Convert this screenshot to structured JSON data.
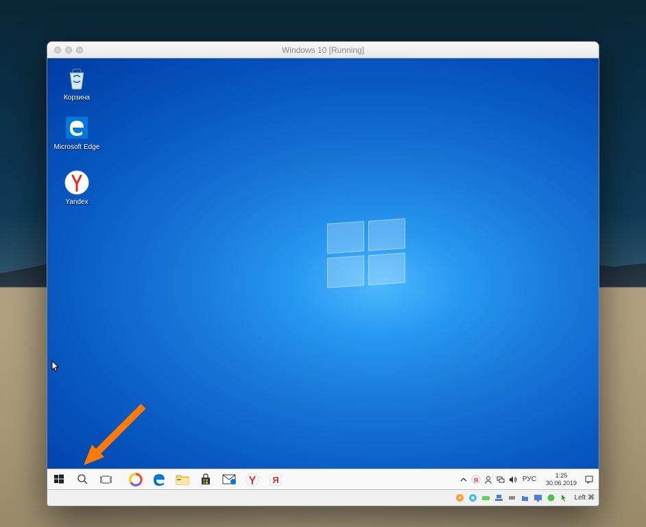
{
  "window": {
    "title": "Windows 10 [Running]"
  },
  "desktop_icons": [
    {
      "name": "recycle-bin",
      "label": "Корзина"
    },
    {
      "name": "edge",
      "label": "Microsoft Edge"
    },
    {
      "name": "yandex",
      "label": "Yandex"
    }
  ],
  "taskbar": {
    "items": [
      {
        "name": "start-button"
      },
      {
        "name": "search-button"
      },
      {
        "name": "task-view-button"
      },
      {
        "name": "yandex-browser"
      },
      {
        "name": "edge-browser"
      },
      {
        "name": "file-explorer"
      },
      {
        "name": "microsoft-store"
      },
      {
        "name": "mail-app"
      },
      {
        "name": "yandex-disk"
      },
      {
        "name": "yandex-app"
      }
    ]
  },
  "systray": {
    "items": [
      {
        "name": "chevron-up-icon"
      },
      {
        "name": "yandex-tray-icon"
      },
      {
        "name": "people-icon"
      },
      {
        "name": "network-icon"
      },
      {
        "name": "volume-icon"
      }
    ],
    "language": "РУС",
    "time": "1:25",
    "date": "30.06.2019"
  },
  "host_statusbar": {
    "host_key": "Left ⌘"
  },
  "annotation": {
    "target": "search-button"
  }
}
